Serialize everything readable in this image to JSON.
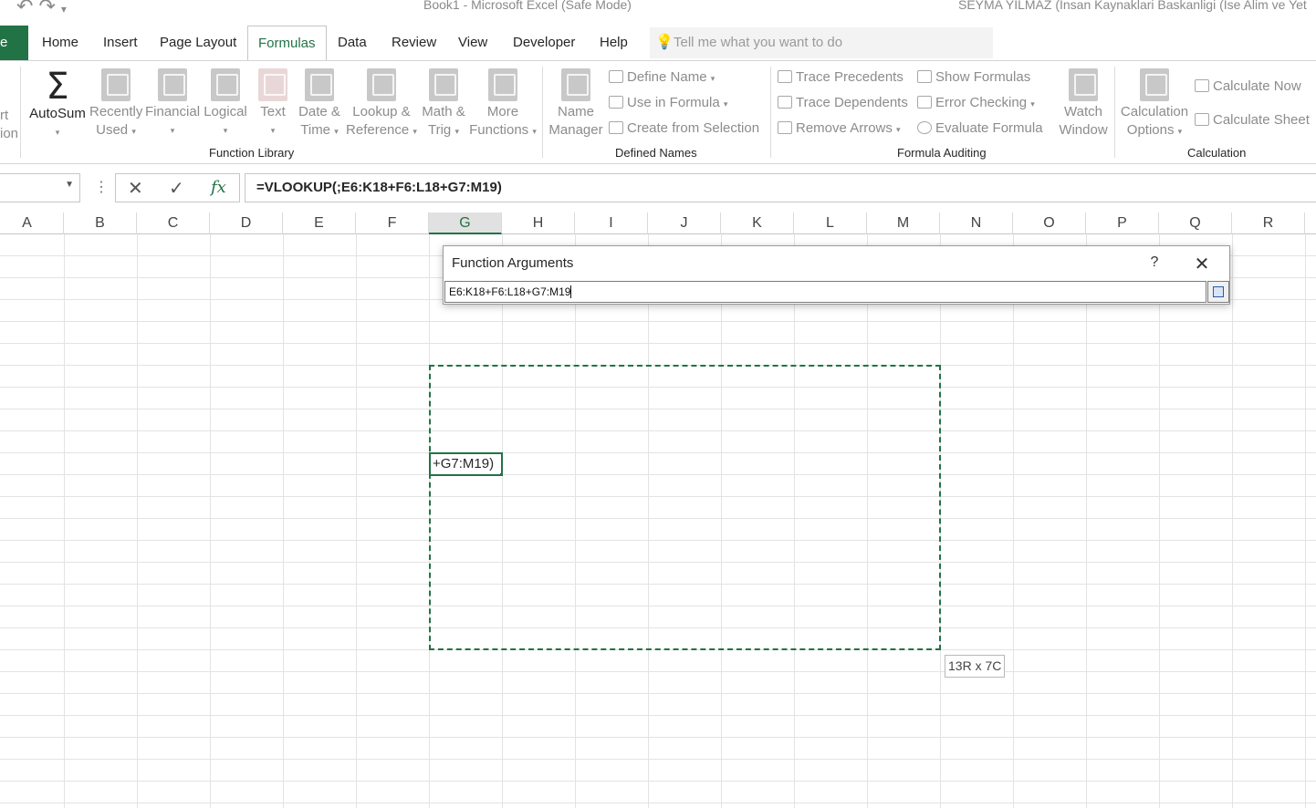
{
  "window": {
    "title": "Book1  -  Microsoft Excel (Safe Mode)",
    "user": "SEYMA YILMAZ (Insan Kaynaklari Baskanligi (Ise Alim ve Yet"
  },
  "tabs": {
    "file": "e",
    "items": [
      "Home",
      "Insert",
      "Page Layout",
      "Formulas",
      "Data",
      "Review",
      "View",
      "Developer",
      "Help"
    ],
    "active": "Formulas",
    "tell_me_placeholder": "Tell me what you want to do"
  },
  "ribbon": {
    "left_cut": {
      "line1": "rt",
      "line2": "ion"
    },
    "function_library": {
      "label": "Function Library",
      "autosum": "AutoSum",
      "recently_used": [
        "Recently",
        "Used"
      ],
      "financial": "Financial",
      "logical": "Logical",
      "text": "Text",
      "date_time": [
        "Date &",
        "Time"
      ],
      "lookup": [
        "Lookup &",
        "Reference"
      ],
      "math": [
        "Math &",
        "Trig"
      ],
      "more": [
        "More",
        "Functions"
      ]
    },
    "defined_names": {
      "label": "Defined Names",
      "name_manager": [
        "Name",
        "Manager"
      ],
      "define_name": "Define Name",
      "use_in_formula": "Use in Formula",
      "create_from_selection": "Create from Selection"
    },
    "formula_auditing": {
      "label": "Formula Auditing",
      "trace_precedents": "Trace Precedents",
      "trace_dependents": "Trace Dependents",
      "remove_arrows": "Remove Arrows",
      "show_formulas": "Show Formulas",
      "error_checking": "Error Checking",
      "evaluate_formula": "Evaluate Formula",
      "watch_window": [
        "Watch",
        "Window"
      ]
    },
    "calculation": {
      "label": "Calculation",
      "options": [
        "Calculation",
        "Options"
      ],
      "calculate_now": "Calculate Now",
      "calculate_sheet": "Calculate Sheet"
    }
  },
  "formula_bar": {
    "formula": "=VLOOKUP(;E6:K18+F6:L18+G7:M19)",
    "fx": "fx"
  },
  "columns": [
    "A",
    "B",
    "C",
    "D",
    "E",
    "F",
    "G",
    "H",
    "I",
    "J",
    "K",
    "L",
    "M",
    "N",
    "O",
    "P",
    "Q",
    "R"
  ],
  "selected_column": "G",
  "active_cell_text": "+G7:M19)",
  "size_tooltip": "13R x 7C",
  "dialog": {
    "title": "Function Arguments",
    "help": "?",
    "input_value": "E6:K18+F6:L18+G7:M19"
  },
  "colors": {
    "accent": "#217346"
  }
}
